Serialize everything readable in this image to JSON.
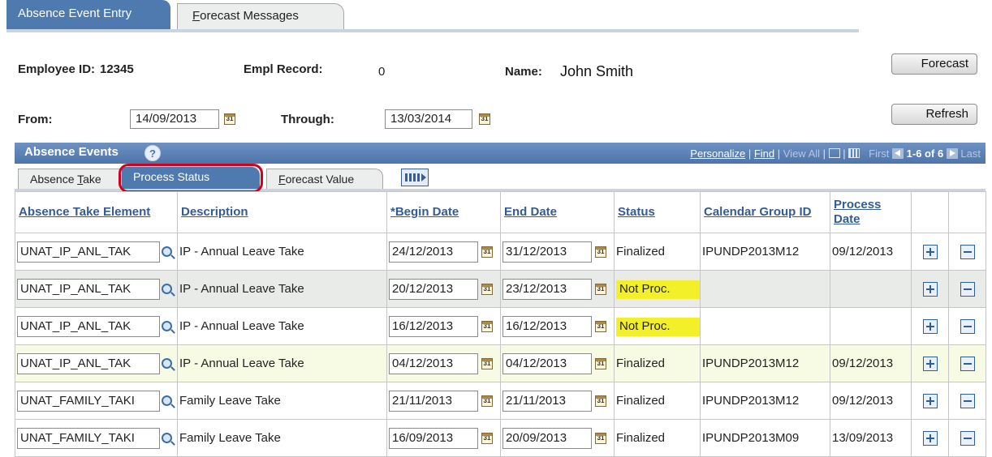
{
  "tabs": {
    "active": "Absence Event Entry",
    "inactive": "Forecast Messages",
    "inactive_ul": "F",
    "inactive_rest": "orecast Messages"
  },
  "header": {
    "employee_id_label": "Employee ID:",
    "employee_id": "12345",
    "empl_record_label": "Empl Record:",
    "empl_record": "0",
    "name_label": "Name:",
    "name": "John Smith",
    "from_label": "From:",
    "from_date": "14/09/2013",
    "through_label": "Through:",
    "through_date": "13/03/2014",
    "forecast_button": "Forecast",
    "refresh_button": "Refresh"
  },
  "grid": {
    "title": "Absence Events",
    "nav": {
      "personalize": "Personalize",
      "sep1": " | ",
      "find": "Find",
      "sep2": " | ",
      "view_all": "View All",
      "sep3": " | ",
      "first": "First",
      "range": "1-6 of 6",
      "last": "Last"
    },
    "subtabs": {
      "absence_take_pre": "Absence ",
      "absence_take_ul": "T",
      "absence_take_post": "ake",
      "process_status": "Process Status",
      "forecast_value_ul": "F",
      "forecast_value_post": "orecast Value"
    },
    "columns": {
      "element": "Absence Take Element",
      "description": "Description",
      "begin": "*Begin Date",
      "end": "End Date",
      "status": "Status",
      "calendar": "Calendar Group ID",
      "process": "Process Date"
    },
    "rows": [
      {
        "element": "UNAT_IP_ANL_TAK",
        "description": "IP - Annual Leave Take",
        "begin": "24/12/2013",
        "end": "31/12/2013",
        "status": "Finalized",
        "calendar": "IPUNDP2013M12",
        "process": "09/12/2013"
      },
      {
        "element": "UNAT_IP_ANL_TAK",
        "description": "IP - Annual Leave Take",
        "begin": "20/12/2013",
        "end": "23/12/2013",
        "status": "Not Proc.",
        "calendar": "",
        "process": ""
      },
      {
        "element": "UNAT_IP_ANL_TAK",
        "description": "IP - Annual Leave Take",
        "begin": "16/12/2013",
        "end": "16/12/2013",
        "status": "Not Proc.",
        "calendar": "",
        "process": ""
      },
      {
        "element": "UNAT_IP_ANL_TAK",
        "description": "IP - Annual Leave Take",
        "begin": "04/12/2013",
        "end": "04/12/2013",
        "status": "Finalized",
        "calendar": "IPUNDP2013M12",
        "process": "09/12/2013"
      },
      {
        "element": "UNAT_FAMILY_TAKI",
        "description": "Family Leave Take",
        "begin": "21/11/2013",
        "end": "21/11/2013",
        "status": "Finalized",
        "calendar": "IPUNDP2013M12",
        "process": "09/12/2013"
      },
      {
        "element": "UNAT_FAMILY_TAKI",
        "description": "Family Leave Take",
        "begin": "16/09/2013",
        "end": "20/09/2013",
        "status": "Finalized",
        "calendar": "IPUNDP2013M09",
        "process": "13/09/2013"
      }
    ]
  },
  "icons": {
    "calendar": "calendar-icon",
    "lookup": "magnifier-icon",
    "add": "plus-icon",
    "delete": "minus-icon"
  },
  "colors": {
    "header_blue": "#4f7ab0",
    "link_blue": "#345c92",
    "highlight_yellow": "#f3f02a",
    "ring_red": "#d4001a"
  }
}
